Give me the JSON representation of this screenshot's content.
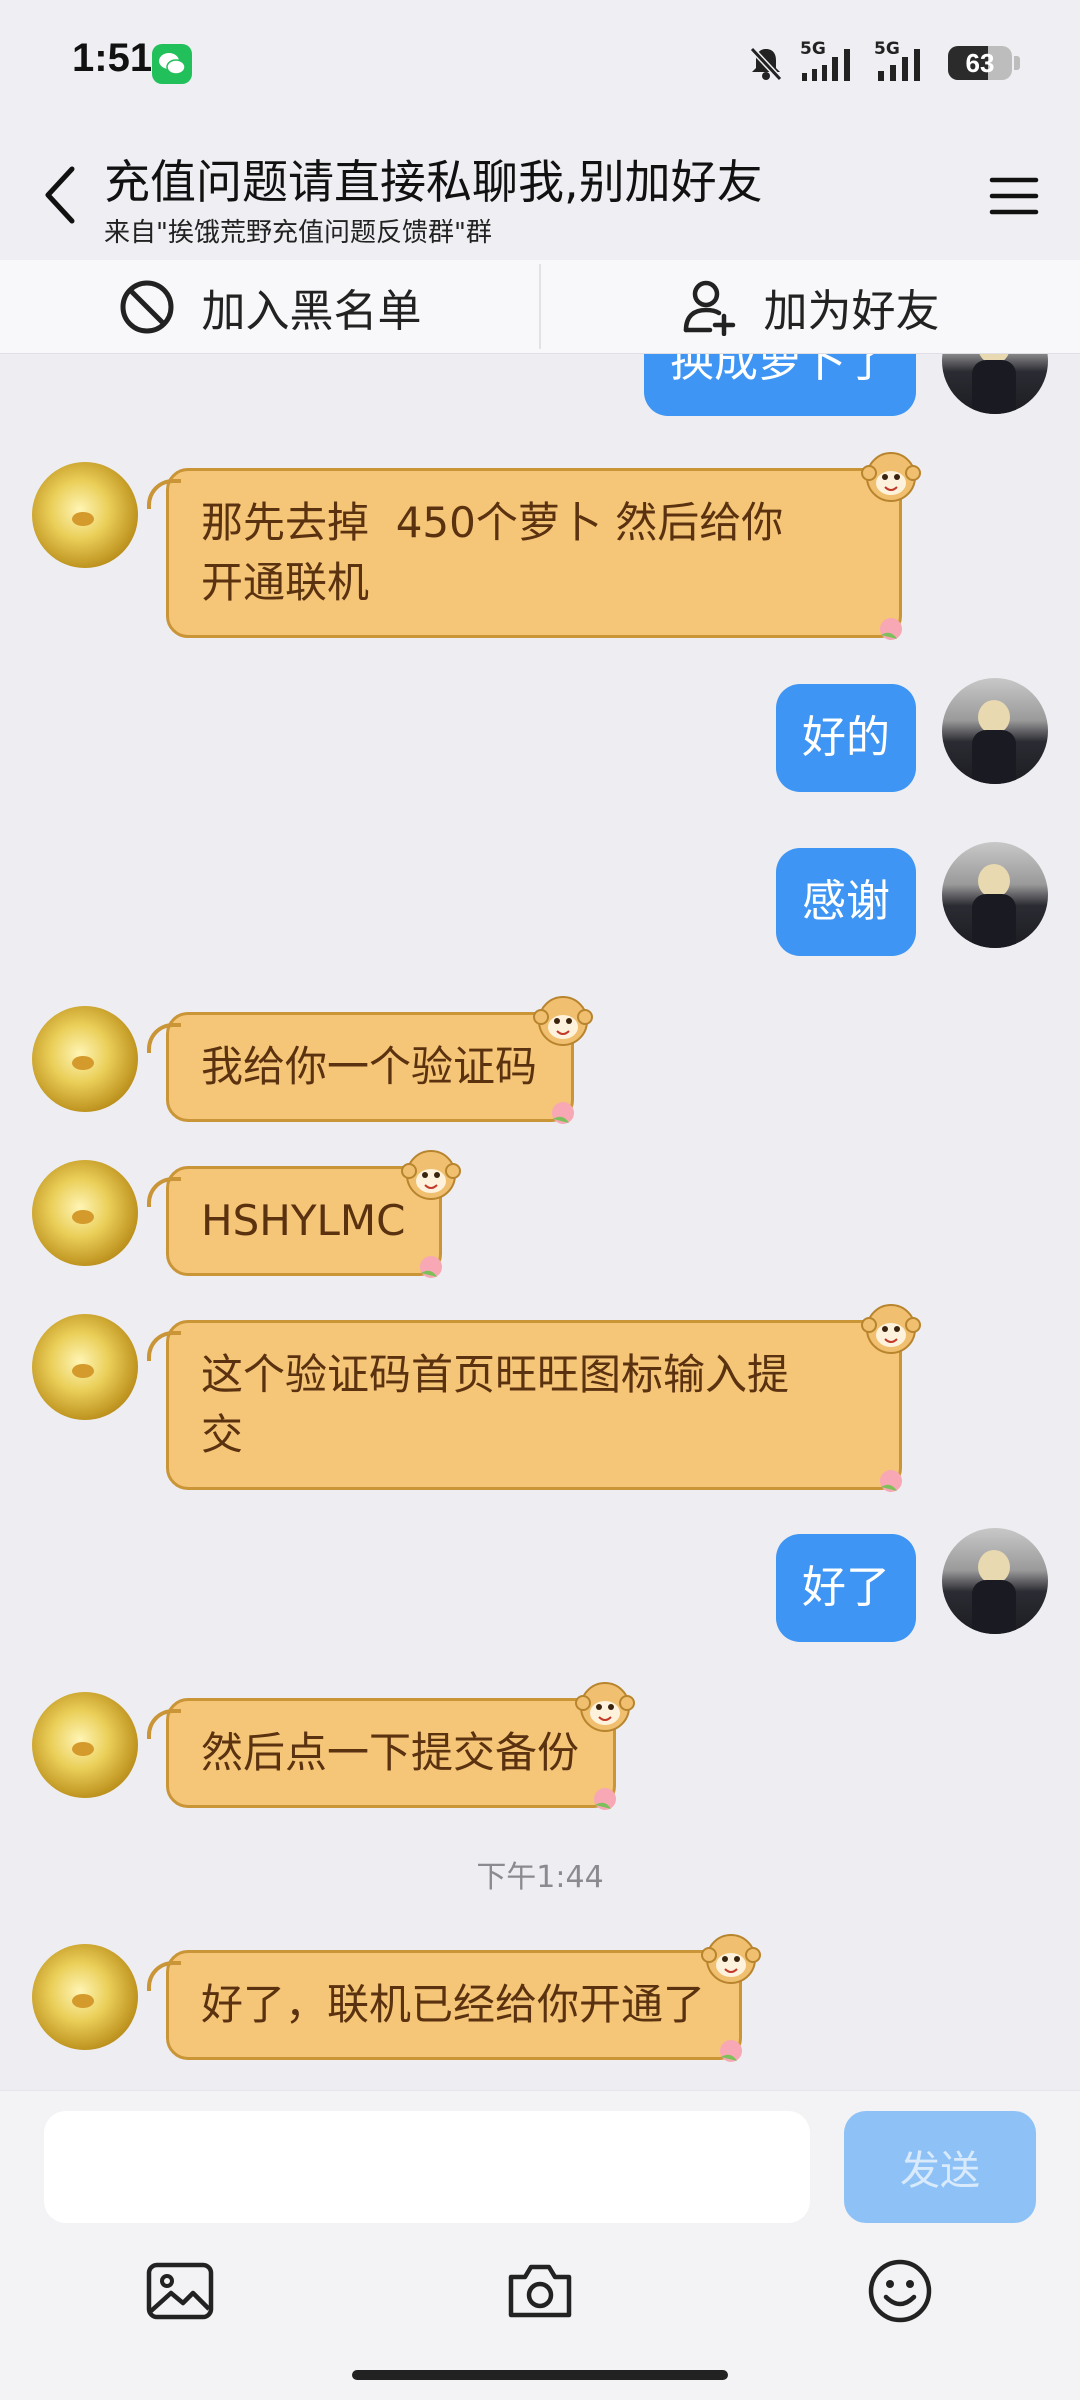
{
  "status_bar": {
    "time": "1:51",
    "network_1": "5G",
    "network_2": "5G",
    "battery": "63",
    "battery_level": 0.63
  },
  "header": {
    "title": "充值问题请直接私聊我,别加好友",
    "subtitle": "来自\"挨饿荒野充值问题反馈群\"群"
  },
  "actions": {
    "blacklist_label": "加入黑名单",
    "add_friend_label": "加为好友"
  },
  "messages": [
    {
      "side": "out",
      "text": "换成萝卜了"
    },
    {
      "side": "in",
      "lines": [
        "那先去掉  450个萝卜 然后给你",
        "开通联机"
      ]
    },
    {
      "side": "out",
      "text": "好的"
    },
    {
      "side": "out",
      "text": "感谢"
    },
    {
      "side": "in",
      "lines": [
        "我给你一个验证码"
      ]
    },
    {
      "side": "in",
      "lines": [
        "HSHYLMC"
      ]
    },
    {
      "side": "in",
      "lines": [
        "这个验证码首页旺旺图标输入提",
        "交"
      ]
    },
    {
      "side": "out",
      "text": "好了"
    },
    {
      "side": "in",
      "lines": [
        "然后点一下提交备份"
      ]
    },
    {
      "side": "time",
      "text": "下午1:44"
    },
    {
      "side": "in",
      "lines": [
        "好了，联机已经给你开通了"
      ]
    }
  ],
  "input": {
    "value": "",
    "send_label": "发送"
  },
  "colors": {
    "incoming_bubble": "#f5c578",
    "outgoing_bubble": "#3e95f3",
    "send_disabled": "#8ec2f6"
  },
  "icons": {
    "back": "chevron-left-icon",
    "menu": "hamburger-menu-icon",
    "blacklist": "block-icon",
    "add_friend": "add-user-icon",
    "image": "image-icon",
    "camera": "camera-icon",
    "emoji": "emoji-icon"
  }
}
